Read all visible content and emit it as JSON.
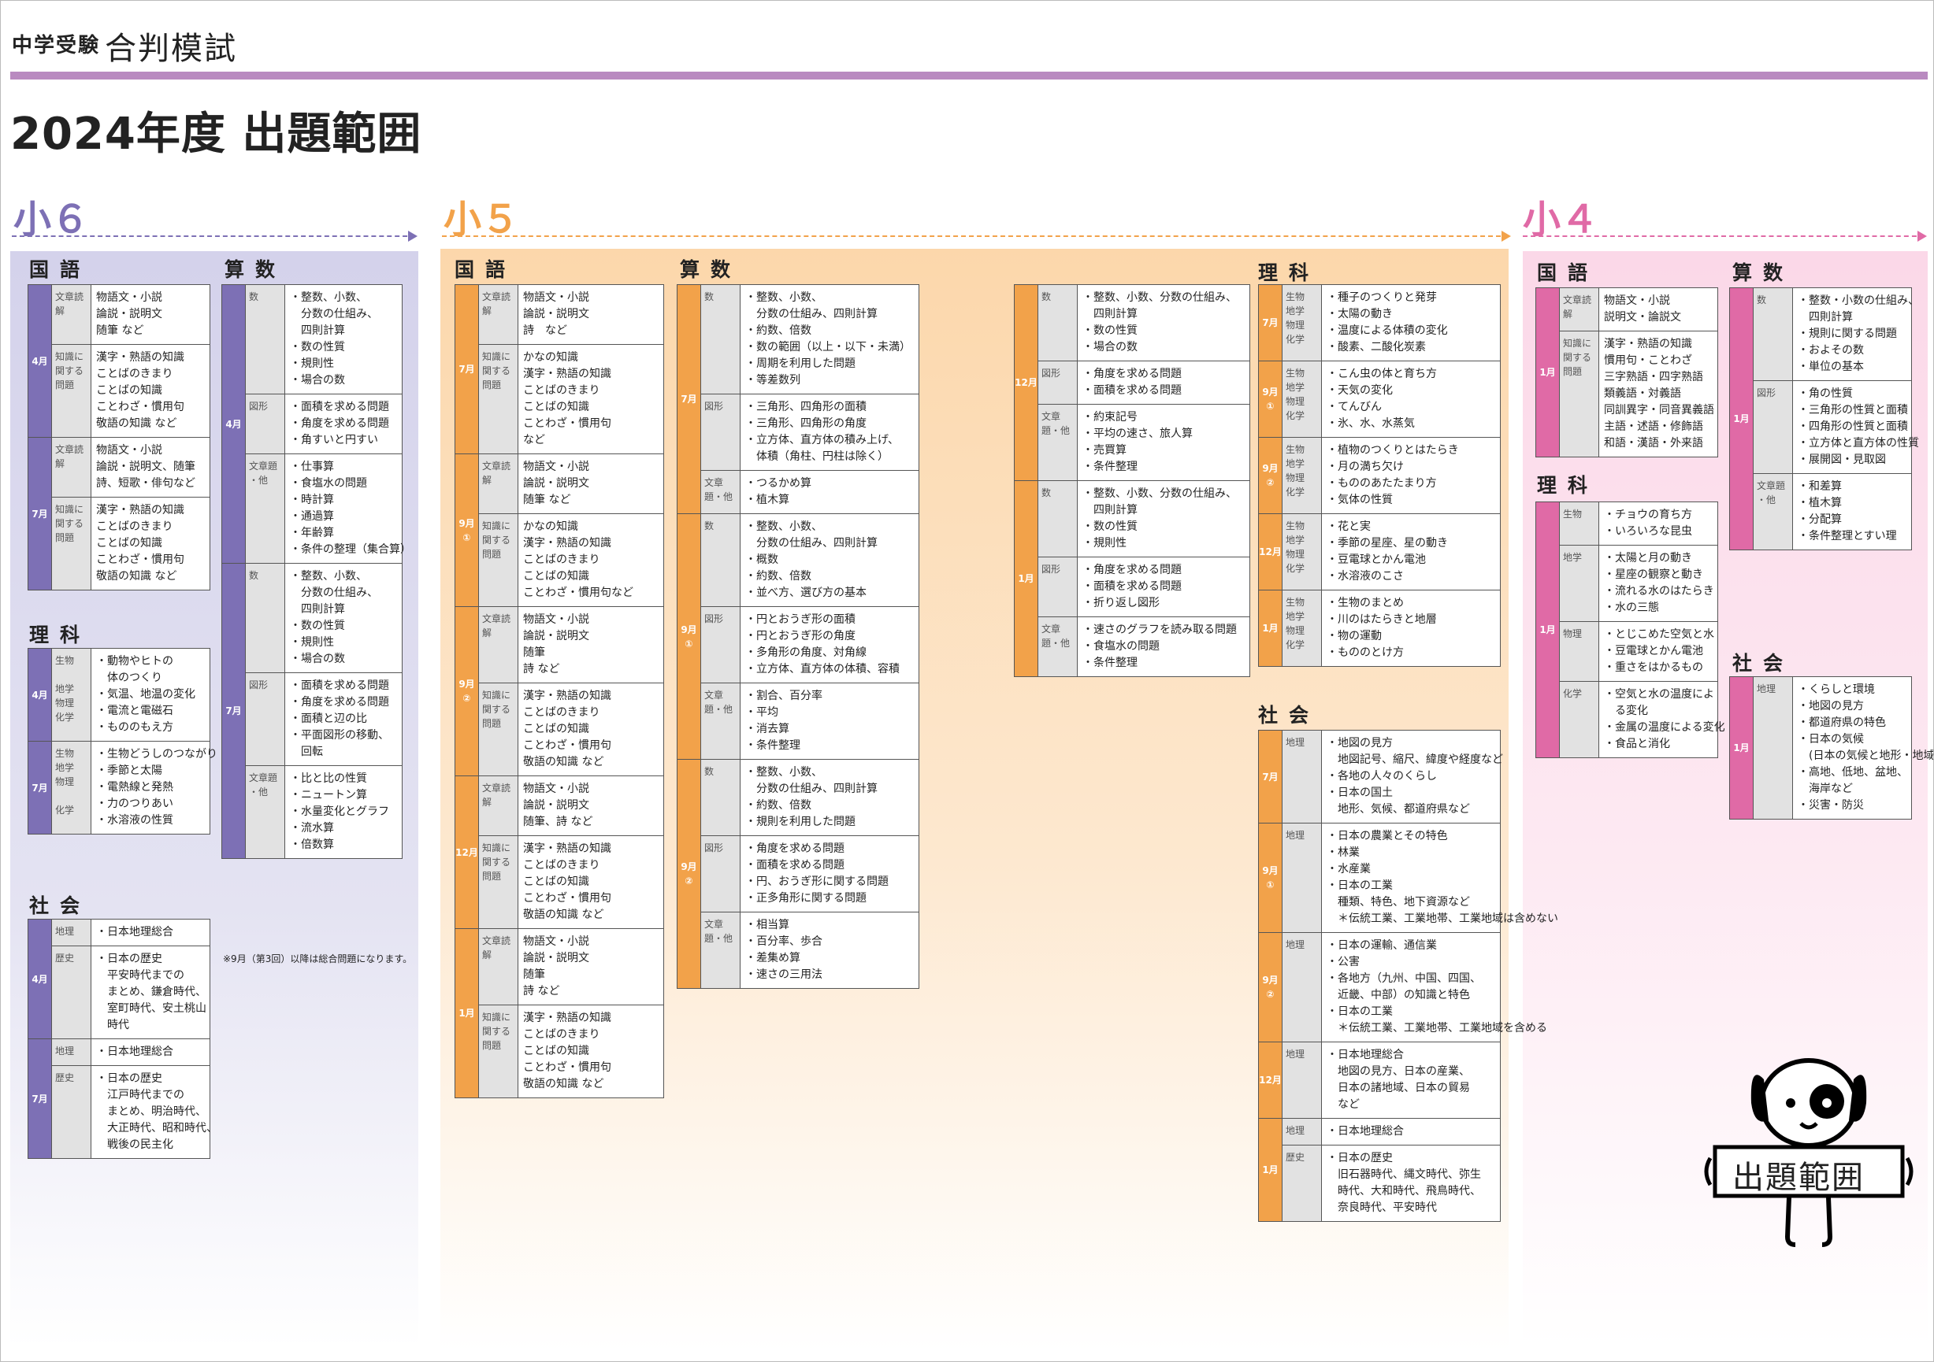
{
  "header": {
    "sub": "中学受験",
    "name": "合判模試",
    "title": "2024年度 出題範囲"
  },
  "grades": {
    "g6": "小６",
    "g5": "小５",
    "g4": "小４"
  },
  "colors": {
    "g6": "#7d70b5",
    "g5": "#f2a24a",
    "g4": "#e06aa6",
    "header_rule": "#b98ac0"
  },
  "g6": {
    "kokugo": {
      "title": "国語",
      "rows": [
        {
          "m": "4月",
          "c": "文章読解",
          "x": "物語文・小説\n論説・説明文\n随筆 など"
        },
        {
          "c": "知識に関する問題",
          "x": "漢字・熟語の知識\nことばのきまり\nことばの知識\nことわざ・慣用句\n敬語の知識 など"
        },
        {
          "m": "7月",
          "c": "文章読解",
          "x": "物語文・小説\n論説・説明文、随筆\n詩、短歌・俳句など"
        },
        {
          "c": "知識に関する問題",
          "x": "漢字・熟語の知識\nことばのきまり\nことばの知識\nことわざ・慣用句\n敬語の知識 など"
        }
      ]
    },
    "rika": {
      "title": "理科",
      "rows": [
        {
          "m": "4月",
          "c": "生物\n\n地学\n物理\n化学",
          "x": "・動物やヒトの\n　体のつくり\n・気温、地温の変化\n・電流と電磁石\n・もののもえ方"
        },
        {
          "m": "7月",
          "c": "生物\n地学\n物理\n\n化学",
          "x": "・生物どうしのつながり\n・季節と太陽\n・電熱線と発熱\n・力のつりあい\n・水溶液の性質"
        }
      ]
    },
    "shakai": {
      "title": "社会",
      "rows": [
        {
          "m": "4月",
          "c": "地理",
          "x": "・日本地理総合"
        },
        {
          "c": "歴史",
          "x": "・日本の歴史\n　平安時代までの\n　まとめ、鎌倉時代、\n　室町時代、安土桃山\n　時代"
        },
        {
          "m": "7月",
          "c": "地理",
          "x": "・日本地理総合"
        },
        {
          "c": "歴史",
          "x": "・日本の歴史\n　江戸時代までの\n　まとめ、明治時代、\n　大正時代、昭和時代、\n　戦後の民主化"
        }
      ]
    },
    "sansu": {
      "title": "算数",
      "rows": [
        {
          "m": "4月",
          "c": "数",
          "x": "・整数、小数、\n　分数の仕組み、\n　四則計算\n・数の性質\n・規則性\n・場合の数"
        },
        {
          "c": "図形",
          "x": "・面積を求める問題\n・角度を求める問題\n・角すいと円すい"
        },
        {
          "c": "文章題\n・他",
          "x": "・仕事算\n・食塩水の問題\n・時計算\n・通過算\n・年齢算\n・条件の整理（集合算）"
        },
        {
          "m": "7月",
          "c": "数",
          "x": "・整数、小数、\n　分数の仕組み、\n　四則計算\n・数の性質\n・規則性\n・場合の数"
        },
        {
          "c": "図形",
          "x": "・面積を求める問題\n・角度を求める問題\n・面積と辺の比\n・平面図形の移動、\n　回転"
        },
        {
          "c": "文章題\n・他",
          "x": "・比と比の性質\n・ニュートン算\n・水量変化とグラフ\n・流水算\n・倍数算"
        }
      ]
    },
    "note": "※9月（第3回）以降は総合問題になります。"
  },
  "g5": {
    "kokugo": {
      "title": "国語",
      "rows": [
        {
          "m": "7月",
          "c": "文章読解",
          "x": "物語文・小説\n論説・説明文\n詩　など"
        },
        {
          "c": "知識に関する問題",
          "x": "かなの知識\n漢字・熟語の知識\nことばのきまり\nことばの知識\nことわざ・慣用句\nなど"
        },
        {
          "m": "9月①",
          "c": "文章読解",
          "x": "物語文・小説\n論説・説明文\n随筆 など"
        },
        {
          "c": "知識に関する問題",
          "x": "かなの知識\n漢字・熟語の知識\nことばのきまり\nことばの知識\nことわざ・慣用句など"
        },
        {
          "m": "9月②",
          "c": "文章読解",
          "x": "物語文・小説\n論説・説明文\n随筆\n詩 など"
        },
        {
          "c": "知識に関する問題",
          "x": "漢字・熟語の知識\nことばのきまり\nことばの知識\nことわざ・慣用句\n敬語の知識 など"
        },
        {
          "m": "12月",
          "c": "文章読解",
          "x": "物語文・小説\n論説・説明文\n随筆、詩 など"
        },
        {
          "c": "知識に関する問題",
          "x": "漢字・熟語の知識\nことばのきまり\nことばの知識\nことわざ・慣用句\n敬語の知識 など"
        },
        {
          "m": "1月",
          "c": "文章読解",
          "x": "物語文・小説\n論説・説明文\n随筆\n詩 など"
        },
        {
          "c": "知識に関する問題",
          "x": "漢字・熟語の知識\nことばのきまり\nことばの知識\nことわざ・慣用句\n敬語の知識 など"
        }
      ]
    },
    "sansu": {
      "title": "算数",
      "rows": [
        {
          "m": "7月",
          "c": "数",
          "x": "・整数、小数、\n　分数の仕組み、四則計算\n・約数、倍数\n・数の範囲（以上・以下・未満）\n・周期を利用した問題\n・等差数列"
        },
        {
          "c": "図形",
          "x": "・三角形、四角形の面積\n・三角形、四角形の角度\n・立方体、直方体の積み上げ、\n　体積（角柱、円柱は除く）"
        },
        {
          "c": "文章題・他",
          "x": "・つるかめ算\n・植木算"
        },
        {
          "m": "9月①",
          "c": "数",
          "x": "・整数、小数、\n　分数の仕組み、四則計算\n・概数\n・約数、倍数\n・並べ方、選び方の基本"
        },
        {
          "c": "図形",
          "x": "・円とおうぎ形の面積\n・円とおうぎ形の角度\n・多角形の角度、対角線\n・立方体、直方体の体積、容積"
        },
        {
          "c": "文章題・他",
          "x": "・割合、百分率\n・平均\n・消去算\n・条件整理"
        },
        {
          "m": "9月②",
          "c": "数",
          "x": "・整数、小数、\n　分数の仕組み、四則計算\n・約数、倍数\n・規則を利用した問題"
        },
        {
          "c": "図形",
          "x": "・角度を求める問題\n・面積を求める問題\n・円、おうぎ形に関する問題\n・正多角形に関する問題"
        },
        {
          "c": "文章題・他",
          "x": "・相当算\n・百分率、歩合\n・差集め算\n・速さの三用法"
        },
        {
          "m": "12月",
          "c": "数",
          "x": "・整数、小数、分数の仕組み、\n　四則計算\n・数の性質\n・場合の数"
        },
        {
          "c": "図形",
          "x": "・角度を求める問題\n・面積を求める問題"
        },
        {
          "c": "文章題・他",
          "x": "・約束記号\n・平均の速さ、旅人算\n・売買算\n・条件整理"
        },
        {
          "m": "1月",
          "c": "数",
          "x": "・整数、小数、分数の仕組み、\n　四則計算\n・数の性質\n・規則性"
        },
        {
          "c": "図形",
          "x": "・角度を求める問題\n・面積を求める問題\n・折り返し図形"
        },
        {
          "c": "文章題・他",
          "x": "・速さのグラフを読み取る問題\n・食塩水の問題\n・条件整理"
        }
      ]
    },
    "rika": {
      "title": "理科",
      "rows": [
        {
          "m": "7月",
          "c": "生物\n地学\n物理\n化学",
          "x": "・種子のつくりと発芽\n・太陽の動き\n・温度による体積の変化\n・酸素、二酸化炭素"
        },
        {
          "m": "9月①",
          "c": "生物\n地学\n物理\n化学",
          "x": "・こん虫の体と育ち方\n・天気の変化\n・てんびん\n・氷、水、水蒸気"
        },
        {
          "m": "9月②",
          "c": "生物\n地学\n物理\n化学",
          "x": "・植物のつくりとはたらき\n・月の満ち欠け\n・もののあたたまり方\n・気体の性質"
        },
        {
          "m": "12月",
          "c": "生物\n地学\n物理\n化学",
          "x": "・花と実\n・季節の星座、星の動き\n・豆電球とかん電池\n・水溶液のこさ"
        },
        {
          "m": "1月",
          "c": "生物\n地学\n物理\n化学",
          "x": "・生物のまとめ\n・川のはたらきと地層\n・物の運動\n・もののとけ方"
        }
      ]
    },
    "shakai": {
      "title": "社会",
      "rows": [
        {
          "m": "7月",
          "c": "地理",
          "x": "・地図の見方\n　地図記号、縮尺、緯度や経度など\n・各地の人々のくらし\n・日本の国土\n　地形、気候、都道府県など"
        },
        {
          "m": "9月①",
          "c": "地理",
          "x": "・日本の農業とその特色\n・林業\n・水産業\n・日本の工業\n　種類、特色、地下資源など\n　＊伝統工業、工業地帯、工業地域は含めない"
        },
        {
          "m": "9月②",
          "c": "地理",
          "x": "・日本の運輸、通信業\n・公害\n・各地方（九州、中国、四国、\n　近畿、中部）の知識と特色\n・日本の工業\n　＊伝統工業、工業地帯、工業地域を含める"
        },
        {
          "m": "12月",
          "c": "地理",
          "x": "・日本地理総合\n　地図の見方、日本の産業、\n　日本の諸地域、日本の貿易\n　など"
        },
        {
          "m": "1月",
          "c": "地理",
          "x": "・日本地理総合"
        },
        {
          "c": "歴史",
          "x": "・日本の歴史\n　旧石器時代、縄文時代、弥生\n　時代、大和時代、飛鳥時代、\n　奈良時代、平安時代"
        }
      ]
    }
  },
  "g4": {
    "kokugo": {
      "title": "国語",
      "rows": [
        {
          "m": "1月",
          "c": "文章読解",
          "x": "物語文・小説\n説明文・論説文"
        },
        {
          "c": "知識に関する問題",
          "x": "漢字・熟語の知識\n慣用句・ことわざ\n三字熟語・四字熟語\n類義語・対義語\n同訓異字・同音異義語\n主語・述語・修飾語\n和語・漢語・外来語"
        }
      ]
    },
    "rika": {
      "title": "理科",
      "rows": [
        {
          "m": "1月",
          "c": "生物",
          "x": "・チョウの育ち方\n・いろいろな昆虫"
        },
        {
          "c": "地学",
          "x": "・太陽と月の動き\n・星座の観察と動き\n・流れる水のはたらき\n・水の三態"
        },
        {
          "c": "物理",
          "x": "・とじこめた空気と水\n・豆電球とかん電池\n・重さをはかるもの"
        },
        {
          "c": "化学",
          "x": "・空気と水の温度によ\n　る変化\n・金属の温度による変化\n・食品と消化"
        }
      ]
    },
    "sansu": {
      "title": "算数",
      "rows": [
        {
          "m": "1月",
          "c": "数",
          "x": "・整数・小数の仕組み、\n　四則計算\n・規則に関する問題\n・およその数\n・単位の基本"
        },
        {
          "c": "図形",
          "x": "・角の性質\n・三角形の性質と面積\n・四角形の性質と面積\n・立方体と直方体の性質\n・展開図・見取図"
        },
        {
          "c": "文章題\n・他",
          "x": "・和差算\n・植木算\n・分配算\n・条件整理とすい理"
        }
      ]
    },
    "shakai": {
      "title": "社会",
      "rows": [
        {
          "m": "1月",
          "c": "地理",
          "x": "・くらしと環境\n・地図の見方\n・都道府県の特色\n・日本の気候\n　(日本の気候と地形・地域の特色を含む)\n・高地、低地、盆地、\n　海岸など\n・災害・防災"
        }
      ]
    }
  },
  "mascot": {
    "label": "出題範囲"
  }
}
